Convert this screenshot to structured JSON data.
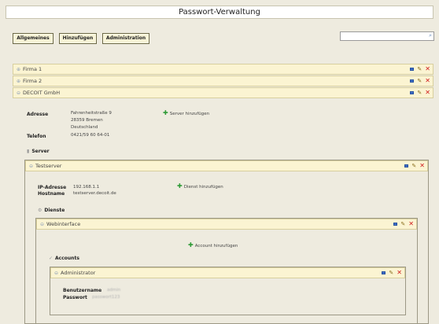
{
  "app": {
    "title": "Passwort-Verwaltung"
  },
  "toolbar": {
    "general_label": "Allgemeines",
    "add_label": "Hinzufügen",
    "admin_label": "Administration",
    "search_placeholder": ""
  },
  "companies": [
    {
      "name": "Firma 1"
    },
    {
      "name": "Firma 2"
    },
    {
      "name": "DECOIT GmbH",
      "address_label": "Adresse",
      "address_lines": [
        "Fahrenheitstraße 9",
        "28359 Bremen",
        "Deutschland"
      ],
      "phone_label": "Telefon",
      "phone": "0421/59 60 64-01",
      "add_server_label": "Server hinzufügen",
      "servers_heading": "Server"
    }
  ],
  "server": {
    "name": "Testserver",
    "ip_label": "IP-Adresse",
    "ip": "192.168.1.1",
    "hostname_label": "Hostname",
    "hostname": "testserver.decoit.de",
    "add_service_label": "Dienst hinzufügen",
    "services_heading": "Dienste"
  },
  "service": {
    "name": "Webinterface",
    "add_account_label": "Account hinzufügen",
    "accounts_heading": "Accounts"
  },
  "account": {
    "name": "Administrator",
    "username_label": "Benutzername",
    "username": "admin",
    "password_label": "Passwort",
    "password": "passwort123"
  },
  "colors": {
    "panel_header": "#fbf4d2",
    "background": "#eeebdf",
    "add": "#2e9a36",
    "delete": "#d01a1a"
  }
}
